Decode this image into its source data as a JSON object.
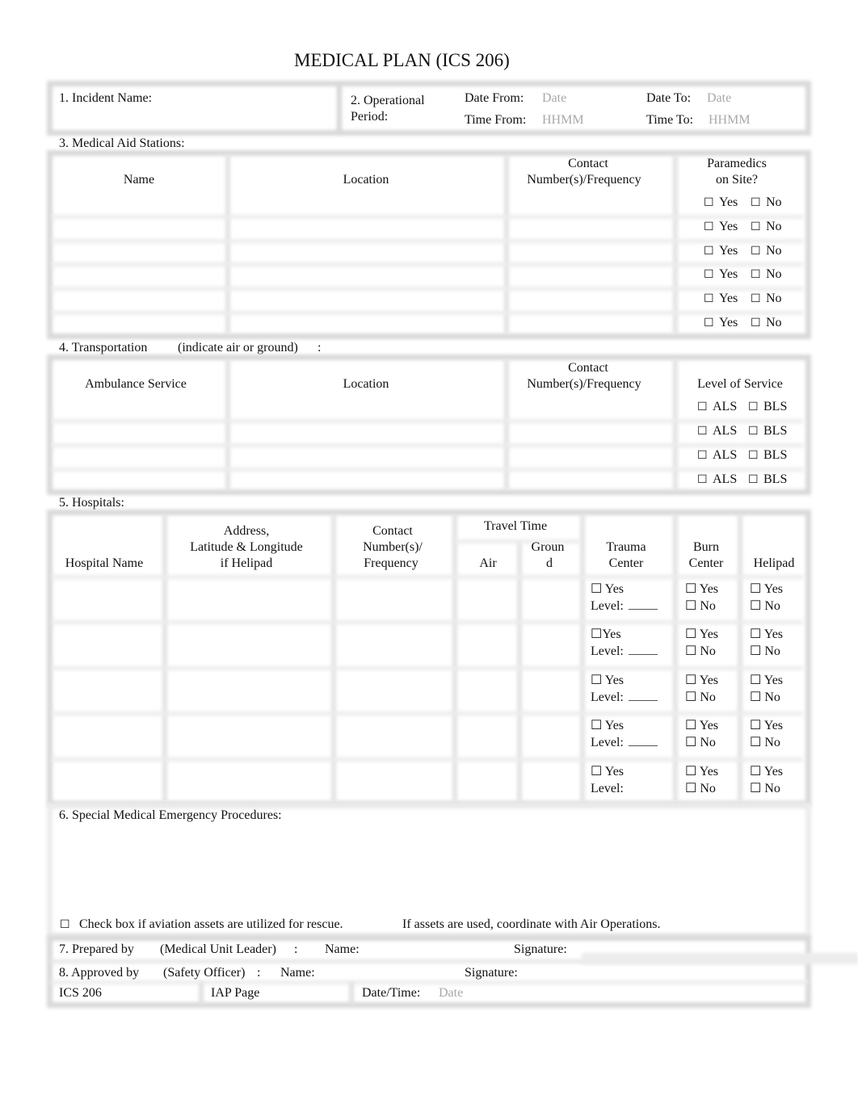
{
  "title": "MEDICAL PLAN (ICS 206)",
  "header": {
    "incident_name_label": "1. Incident Name:",
    "op_period_label_line1": "2. Operational",
    "op_period_label_line2": "Period:",
    "date_from_label": "Date From:",
    "date_from_placeholder": "Date",
    "date_to_label": "Date To:",
    "date_to_placeholder": "Date",
    "time_from_label": "Time From:",
    "time_from_placeholder": "HHMM",
    "time_to_label": "Time To:",
    "time_to_placeholder": "HHMM"
  },
  "aid_stations": {
    "section_label": "3. Medical Aid Stations:",
    "columns": {
      "name": "Name",
      "location": "Location",
      "contact_line1": "Contact",
      "contact_line2": "Number(s)/Frequency",
      "paramedics_line1": "Paramedics",
      "paramedics_line2": "on Site?"
    },
    "checkbox_glyph": "☐",
    "yes_label": "Yes",
    "no_label": "No",
    "row_count": 6
  },
  "transportation": {
    "section_label": "4. Transportation",
    "section_hint": "(indicate air or ground)",
    "section_colon": ":",
    "columns": {
      "ambulance": "Ambulance Service",
      "location": "Location",
      "contact_line1": "Contact",
      "contact_line2": "Number(s)/Frequency",
      "level": "Level of Service"
    },
    "als_label": "ALS",
    "bls_label": "BLS",
    "row_count": 4
  },
  "hospitals": {
    "section_label": "5. Hospitals:",
    "columns": {
      "name": "Hospital Name",
      "address_line1": "Address,",
      "address_line2": "Latitude & Longitude",
      "address_line3": "if Helipad",
      "contact_line1": "Contact",
      "contact_line2": "Number(s)/",
      "contact_line3": "Frequency",
      "travel_time": "Travel Time",
      "air": "Air",
      "ground_line1": "Groun",
      "ground_line2": "d",
      "trauma_line1": "Trauma",
      "trauma_line2": "Center",
      "burn_line1": "Burn",
      "burn_line2": "Center",
      "helipad": "Helipad"
    },
    "rows": [
      {
        "trauma_yes": "☐ Yes",
        "level": "Level:",
        "level_blank": true
      },
      {
        "trauma_yes": "☐Yes",
        "level": "Level:",
        "level_blank": true
      },
      {
        "trauma_yes": "☐ Yes",
        "level": "Level:",
        "level_blank": true
      },
      {
        "trauma_yes": "☐ Yes",
        "level": "Level:",
        "level_blank": true
      },
      {
        "trauma_yes": "☐ Yes",
        "level": "Level:",
        "level_blank": false
      }
    ],
    "yes_label": "☐ Yes",
    "no_label": "☐ No"
  },
  "procedures": {
    "section_label": "6. Special Medical Emergency Procedures:",
    "aviation_checkbox": "☐",
    "aviation_label": "Check box if aviation assets are utilized for rescue.",
    "aviation_note": "If assets are used, coordinate with Air Operations."
  },
  "footer": {
    "prepared_label": "7. Prepared by",
    "prepared_role": "(Medical Unit Leader)",
    "prepared_colon": ":",
    "prepared_name_label": "Name:",
    "prepared_signature_label": "Signature:",
    "approved_label": "8. Approved by",
    "approved_role": "(Safety Officer)",
    "approved_colon": ":",
    "approved_name_label": "Name:",
    "approved_signature_label": "Signature:",
    "form_id": "ICS 206",
    "iap_page_label": "IAP Page",
    "datetime_label": "Date/Time:",
    "datetime_placeholder": "Date"
  }
}
